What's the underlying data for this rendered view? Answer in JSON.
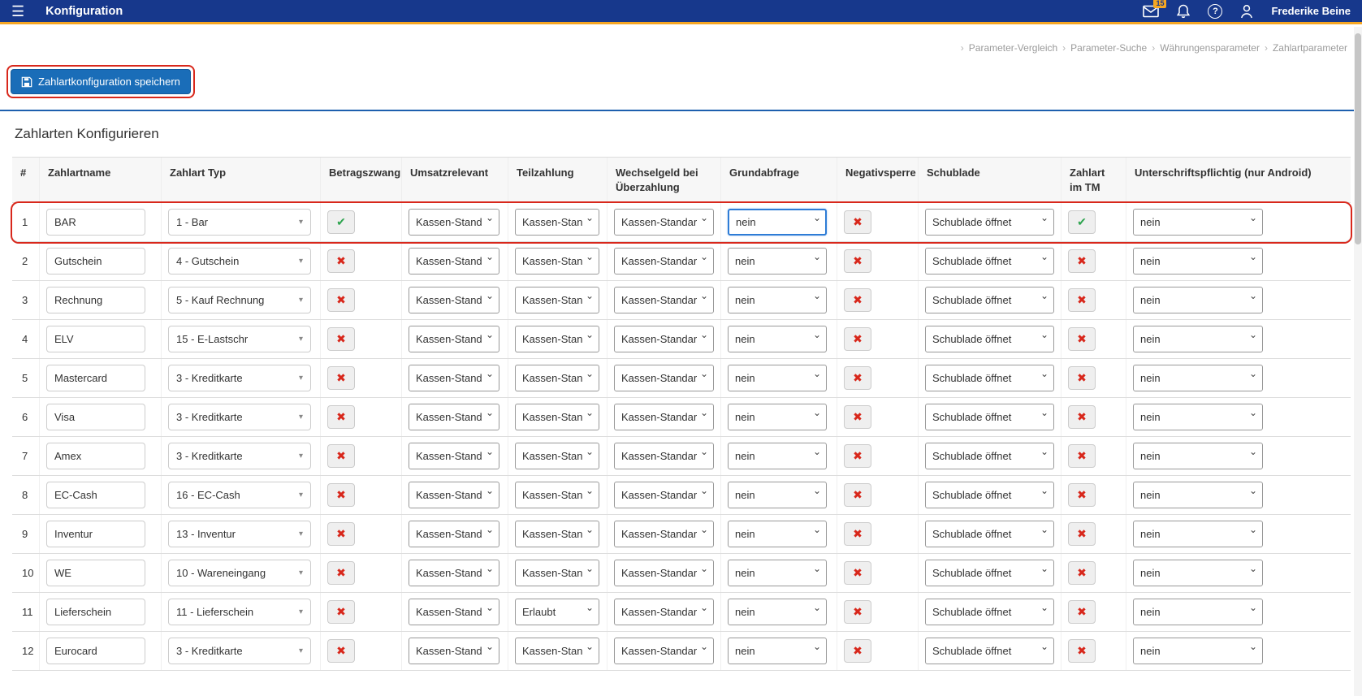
{
  "topbar": {
    "title": "Konfiguration",
    "mail_badge": "15",
    "username": "Frederike Beine"
  },
  "breadcrumb": {
    "items": [
      "Parameter-Vergleich",
      "Parameter-Suche",
      "Währungensparameter",
      "Zahlartparameter"
    ]
  },
  "toolbar": {
    "save_label": "Zahlartkonfiguration speichern"
  },
  "section": {
    "title": "Zahlarten Konfigurieren"
  },
  "colors": {
    "topbar_blue": "#17388c",
    "accent_orange": "#f5a623",
    "button_blue": "#1a6db8",
    "highlight_red": "#d8271b",
    "check_green": "#2ea44f",
    "cross_red": "#d8271b",
    "rule_blue": "#1d5fae"
  },
  "table": {
    "columns": [
      "#",
      "Zahlartname",
      "Zahlart Typ",
      "Betragszwang",
      "Umsatzrelevant",
      "Teilzahlung",
      "Wechselgeld bei Überzahlung",
      "Grundabfrage",
      "Negativsperre",
      "Schublade",
      "Zahlart im TM",
      "Unterschriftspflichtig (nur Android)"
    ],
    "rows": [
      {
        "num": "1",
        "name": "BAR",
        "typ": "1 - Bar",
        "betragszwang": true,
        "umsatzrelevant": "Kassen-Standar",
        "teilzahlung": "Kassen-Stand",
        "wechselgeld": "Kassen-Standard",
        "grundabfrage": "nein",
        "grundabfrage_focused": true,
        "negativsperre": false,
        "schublade": "Schublade öffnet",
        "zahlart_tm": true,
        "unterschrift": "nein",
        "highlight": true
      },
      {
        "num": "2",
        "name": "Gutschein",
        "typ": "4 - Gutschein",
        "betragszwang": false,
        "umsatzrelevant": "Kassen-Standar",
        "teilzahlung": "Kassen-Stand",
        "wechselgeld": "Kassen-Standard",
        "grundabfrage": "nein",
        "grundabfrage_focused": false,
        "negativsperre": false,
        "schublade": "Schublade öffnet",
        "zahlart_tm": false,
        "unterschrift": "nein",
        "highlight": false
      },
      {
        "num": "3",
        "name": "Rechnung",
        "typ": "5 - Kauf Rechnung",
        "betragszwang": false,
        "umsatzrelevant": "Kassen-Standar",
        "teilzahlung": "Kassen-Stand",
        "wechselgeld": "Kassen-Standard",
        "grundabfrage": "nein",
        "grundabfrage_focused": false,
        "negativsperre": false,
        "schublade": "Schublade öffnet",
        "zahlart_tm": false,
        "unterschrift": "nein",
        "highlight": false
      },
      {
        "num": "4",
        "name": "ELV",
        "typ": "15 - E-Lastschr",
        "betragszwang": false,
        "umsatzrelevant": "Kassen-Standar",
        "teilzahlung": "Kassen-Stand",
        "wechselgeld": "Kassen-Standard",
        "grundabfrage": "nein",
        "grundabfrage_focused": false,
        "negativsperre": false,
        "schublade": "Schublade öffnet",
        "zahlart_tm": false,
        "unterschrift": "nein",
        "highlight": false
      },
      {
        "num": "5",
        "name": "Mastercard",
        "typ": "3 - Kreditkarte",
        "betragszwang": false,
        "umsatzrelevant": "Kassen-Standar",
        "teilzahlung": "Kassen-Stand",
        "wechselgeld": "Kassen-Standard",
        "grundabfrage": "nein",
        "grundabfrage_focused": false,
        "negativsperre": false,
        "schublade": "Schublade öffnet",
        "zahlart_tm": false,
        "unterschrift": "nein",
        "highlight": false
      },
      {
        "num": "6",
        "name": "Visa",
        "typ": "3 - Kreditkarte",
        "betragszwang": false,
        "umsatzrelevant": "Kassen-Standar",
        "teilzahlung": "Kassen-Stand",
        "wechselgeld": "Kassen-Standard",
        "grundabfrage": "nein",
        "grundabfrage_focused": false,
        "negativsperre": false,
        "schublade": "Schublade öffnet",
        "zahlart_tm": false,
        "unterschrift": "nein",
        "highlight": false
      },
      {
        "num": "7",
        "name": "Amex",
        "typ": "3 - Kreditkarte",
        "betragszwang": false,
        "umsatzrelevant": "Kassen-Standar",
        "teilzahlung": "Kassen-Stand",
        "wechselgeld": "Kassen-Standard",
        "grundabfrage": "nein",
        "grundabfrage_focused": false,
        "negativsperre": false,
        "schublade": "Schublade öffnet",
        "zahlart_tm": false,
        "unterschrift": "nein",
        "highlight": false
      },
      {
        "num": "8",
        "name": "EC-Cash",
        "typ": "16 - EC-Cash",
        "betragszwang": false,
        "umsatzrelevant": "Kassen-Standar",
        "teilzahlung": "Kassen-Stand",
        "wechselgeld": "Kassen-Standard",
        "grundabfrage": "nein",
        "grundabfrage_focused": false,
        "negativsperre": false,
        "schublade": "Schublade öffnet",
        "zahlart_tm": false,
        "unterschrift": "nein",
        "highlight": false
      },
      {
        "num": "9",
        "name": "Inventur",
        "typ": "13 - Inventur",
        "betragszwang": false,
        "umsatzrelevant": "Kassen-Standar",
        "teilzahlung": "Kassen-Stand",
        "wechselgeld": "Kassen-Standard",
        "grundabfrage": "nein",
        "grundabfrage_focused": false,
        "negativsperre": false,
        "schublade": "Schublade öffnet",
        "zahlart_tm": false,
        "unterschrift": "nein",
        "highlight": false
      },
      {
        "num": "10",
        "name": "WE",
        "typ": "10 - Wareneingang",
        "betragszwang": false,
        "umsatzrelevant": "Kassen-Standar",
        "teilzahlung": "Kassen-Stand",
        "wechselgeld": "Kassen-Standard",
        "grundabfrage": "nein",
        "grundabfrage_focused": false,
        "negativsperre": false,
        "schublade": "Schublade öffnet",
        "zahlart_tm": false,
        "unterschrift": "nein",
        "highlight": false
      },
      {
        "num": "11",
        "name": "Lieferschein",
        "typ": "11 - Lieferschein",
        "betragszwang": false,
        "umsatzrelevant": "Kassen-Standar",
        "teilzahlung": "Erlaubt",
        "wechselgeld": "Kassen-Standard",
        "grundabfrage": "nein",
        "grundabfrage_focused": false,
        "negativsperre": false,
        "schublade": "Schublade öffnet",
        "zahlart_tm": false,
        "unterschrift": "nein",
        "highlight": false
      },
      {
        "num": "12",
        "name": "Eurocard",
        "typ": "3 - Kreditkarte",
        "betragszwang": false,
        "umsatzrelevant": "Kassen-Standar",
        "teilzahlung": "Kassen-Stand",
        "wechselgeld": "Kassen-Standard",
        "grundabfrage": "nein",
        "grundabfrage_focused": false,
        "negativsperre": false,
        "schublade": "Schublade öffnet",
        "zahlart_tm": false,
        "unterschrift": "nein",
        "highlight": false
      }
    ]
  }
}
